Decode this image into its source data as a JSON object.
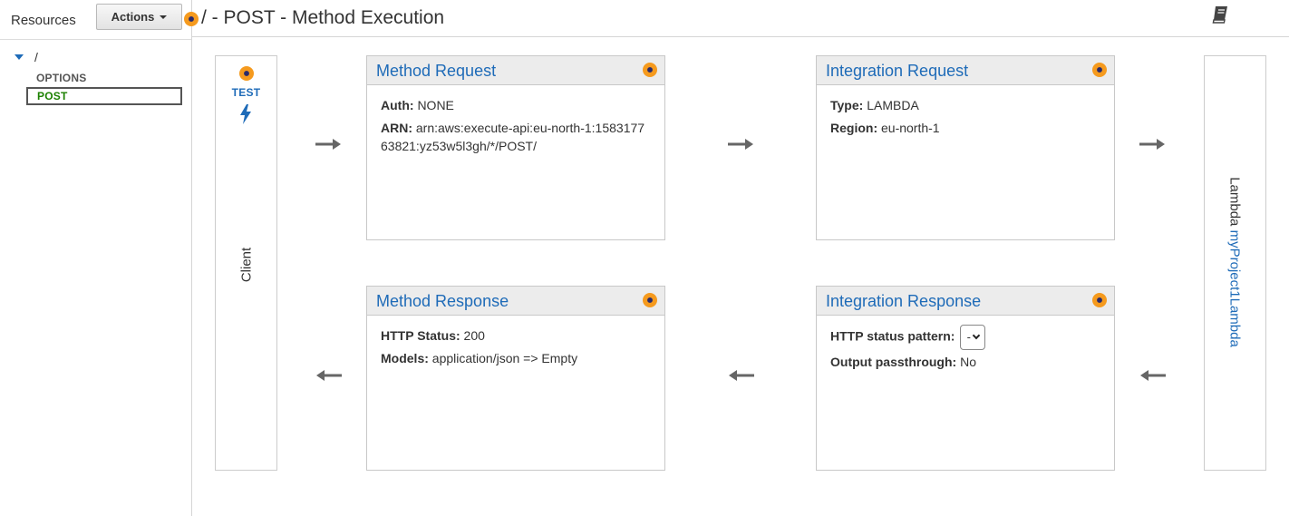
{
  "sidebar": {
    "title": "Resources",
    "actions_label": "Actions",
    "tree": {
      "root": "/",
      "methods": [
        "OPTIONS",
        "POST"
      ],
      "selected": "POST"
    }
  },
  "header": {
    "title": "/ - POST - Method Execution"
  },
  "client": {
    "test_label": "TEST",
    "label": "Client"
  },
  "lambda": {
    "prefix": "Lambda",
    "function_name": "myProject1Lambda"
  },
  "method_request": {
    "title": "Method Request",
    "auth_label": "Auth:",
    "auth_value": "NONE",
    "arn_label": "ARN:",
    "arn_value": "arn:aws:execute-api:eu-north-1:158317763821:yz53w5l3gh/*/POST/"
  },
  "integration_request": {
    "title": "Integration Request",
    "type_label": "Type:",
    "type_value": "LAMBDA",
    "region_label": "Region:",
    "region_value": "eu-north-1"
  },
  "method_response": {
    "title": "Method Response",
    "status_label": "HTTP Status:",
    "status_value": "200",
    "models_label": "Models:",
    "models_value": "application/json => Empty"
  },
  "integration_response": {
    "title": "Integration Response",
    "pattern_label": "HTTP status pattern:",
    "pattern_value": "-",
    "passthrough_label": "Output passthrough:",
    "passthrough_value": "No"
  },
  "icons": {
    "help": "help-dot-icon",
    "book": "book-icon",
    "bolt": "lightning-bolt-icon",
    "arrow_right": "arrow-right-icon",
    "arrow_left": "arrow-left-icon"
  },
  "colors": {
    "link_blue": "#1e6bb8",
    "selected_green": "#1d8102",
    "help_orange": "#f59a1e",
    "box_header": "#ececec"
  }
}
